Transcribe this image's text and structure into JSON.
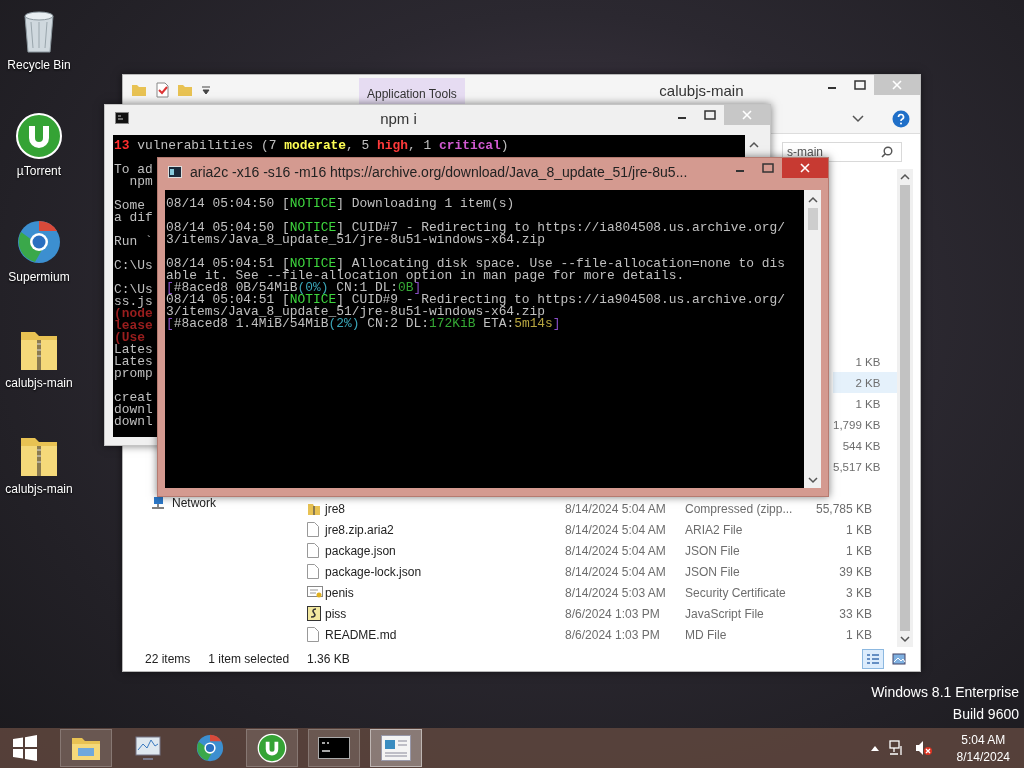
{
  "desktop_icons": [
    {
      "label": "Recycle Bin",
      "kind": "recycle"
    },
    {
      "label": "µTorrent",
      "kind": "utorrent"
    },
    {
      "label": "Supermium",
      "kind": "browser"
    },
    {
      "label": "calubjs-main",
      "kind": "zip"
    },
    {
      "label": "calubjs-main",
      "kind": "zip"
    }
  ],
  "explorer": {
    "title": "calubjs-main",
    "context_tab": "Application Tools",
    "search": {
      "value": "s-main"
    },
    "nav_items": [
      {
        "label": "Network"
      }
    ],
    "rows_behind_windows": [
      {
        "size": "1 KB",
        "selected": false
      },
      {
        "size": "2 KB",
        "selected": true
      },
      {
        "size": "1 KB",
        "selected": false
      },
      {
        "size": "1,799 KB",
        "selected": false
      },
      {
        "size": "544 KB",
        "selected": false
      },
      {
        "size": "5,517 KB",
        "selected": false
      }
    ],
    "rows": [
      {
        "kind": "zip",
        "name": "jre8",
        "date": "8/14/2024 5:04 AM",
        "type": "Compressed (zipp...",
        "size": "55,785 KB",
        "selected": false
      },
      {
        "kind": "file",
        "name": "jre8.zip.aria2",
        "date": "8/14/2024 5:04 AM",
        "type": "ARIA2 File",
        "size": "1 KB",
        "selected": false
      },
      {
        "kind": "file",
        "name": "package.json",
        "date": "8/14/2024 5:04 AM",
        "type": "JSON File",
        "size": "1 KB",
        "selected": false
      },
      {
        "kind": "file",
        "name": "package-lock.json",
        "date": "8/14/2024 5:04 AM",
        "type": "JSON File",
        "size": "39 KB",
        "selected": false
      },
      {
        "kind": "certificate",
        "name": "penis",
        "date": "8/14/2024 5:03 AM",
        "type": "Security Certificate",
        "size": "3 KB",
        "selected": false
      },
      {
        "kind": "script",
        "name": "piss",
        "date": "8/6/2024 1:03 PM",
        "type": "JavaScript File",
        "size": "33 KB",
        "selected": false
      },
      {
        "kind": "file",
        "name": "README.md",
        "date": "8/6/2024 1:03 PM",
        "type": "MD File",
        "size": "1 KB",
        "selected": false
      }
    ],
    "status": {
      "count": "22 items",
      "selection": "1 item selected",
      "selection_size": "1.36 KB"
    },
    "views": [
      {
        "kind": "details",
        "selected": true
      },
      {
        "kind": "tiles",
        "selected": false
      }
    ]
  },
  "npm_window": {
    "title": "npm i",
    "lines": [
      {
        "kind": "text",
        "segments": [
          {
            "text": "13",
            "color": "#ff2d2d"
          },
          {
            "text": " vulnerabilities (7 "
          },
          {
            "text": "moderate",
            "color": "#ffff55"
          },
          {
            "text": ", 5 "
          },
          {
            "text": "high",
            "color": "#ff3b3b"
          },
          {
            "text": ", 1 "
          },
          {
            "text": "critical",
            "color": "#d25ad2"
          },
          {
            "text": ")"
          }
        ]
      },
      {
        "kind": "blank"
      },
      {
        "kind": "text",
        "segments": [
          {
            "text": "To ad"
          }
        ]
      },
      {
        "kind": "text",
        "segments": [
          {
            "text": "  npm"
          }
        ]
      },
      {
        "kind": "blank"
      },
      {
        "kind": "text",
        "segments": [
          {
            "text": "Some"
          }
        ]
      },
      {
        "kind": "text",
        "segments": [
          {
            "text": "a dif"
          }
        ]
      },
      {
        "kind": "blank"
      },
      {
        "kind": "text",
        "segments": [
          {
            "text": "Run `"
          }
        ]
      },
      {
        "kind": "blank"
      },
      {
        "kind": "text",
        "segments": [
          {
            "text": "C:\\Us"
          }
        ]
      },
      {
        "kind": "blank"
      },
      {
        "kind": "text",
        "segments": [
          {
            "text": "C:\\Us"
          }
        ]
      },
      {
        "kind": "text",
        "segments": [
          {
            "text": "ss.js"
          }
        ]
      },
      {
        "kind": "text",
        "segments": [
          {
            "text": "(node",
            "color": "#9a1e1e"
          }
        ]
      },
      {
        "kind": "text",
        "segments": [
          {
            "text": "lease",
            "color": "#9a1e1e"
          }
        ]
      },
      {
        "kind": "text",
        "segments": [
          {
            "text": "(Use",
            "color": "#9a1e1e"
          }
        ]
      },
      {
        "kind": "text",
        "segments": [
          {
            "text": "Lates"
          }
        ]
      },
      {
        "kind": "text",
        "segments": [
          {
            "text": "Lates"
          }
        ]
      },
      {
        "kind": "text",
        "segments": [
          {
            "text": "promp"
          }
        ]
      },
      {
        "kind": "blank"
      },
      {
        "kind": "text",
        "segments": [
          {
            "text": "creat"
          }
        ]
      },
      {
        "kind": "text",
        "segments": [
          {
            "text": "downl"
          }
        ]
      },
      {
        "kind": "text",
        "segments": [
          {
            "text": "downl"
          }
        ]
      }
    ]
  },
  "aria_window": {
    "title": "aria2c  -x16 -s16 -m16 https://archive.org/download/Java_8_update_51/jre-8u5...",
    "lines": [
      {
        "kind": "text",
        "segments": [
          {
            "text": "08/14 05:04:50 ["
          },
          {
            "text": "NOTICE",
            "color": "#3fd83f"
          },
          {
            "text": "] Downloading 1 item(s)"
          }
        ]
      },
      {
        "kind": "blank"
      },
      {
        "kind": "text",
        "segments": [
          {
            "text": "08/14 05:04:50 ["
          },
          {
            "text": "NOTICE",
            "color": "#3fd83f"
          },
          {
            "text": "] CUID#7 - Redirecting to https://ia804508.us.archive.org/"
          }
        ]
      },
      {
        "kind": "text",
        "segments": [
          {
            "text": "3/items/Java_8_update_51/jre-8u51-windows-x64.zip"
          }
        ]
      },
      {
        "kind": "blank"
      },
      {
        "kind": "text",
        "segments": [
          {
            "text": "08/14 05:04:51 ["
          },
          {
            "text": "NOTICE",
            "color": "#3fd83f"
          },
          {
            "text": "] Allocating disk space. Use --file-allocation=none to dis"
          }
        ]
      },
      {
        "kind": "text",
        "segments": [
          {
            "text": "able it. See --file-allocation option in man page for more details."
          }
        ]
      },
      {
        "kind": "text",
        "segments": [
          {
            "text": "[",
            "color": "#8a4fc8"
          },
          {
            "text": "#8aced8 0B/54MiB"
          },
          {
            "text": "(0%)",
            "color": "#3aa6b8"
          },
          {
            "text": " CN:1 DL:"
          },
          {
            "text": "0B",
            "color": "#35a835"
          },
          {
            "text": "]",
            "color": "#8a4fc8"
          }
        ]
      },
      {
        "kind": "text",
        "segments": [
          {
            "text": "08/14 05:04:51 ["
          },
          {
            "text": "NOTICE",
            "color": "#3fd83f"
          },
          {
            "text": "] CUID#9 - Redirecting to https://ia904508.us.archive.org/"
          }
        ]
      },
      {
        "kind": "text",
        "segments": [
          {
            "text": "3/items/Java_8_update_51/jre-8u51-windows-x64.zip"
          }
        ]
      },
      {
        "kind": "text",
        "segments": [
          {
            "text": "[",
            "color": "#8a4fc8"
          },
          {
            "text": "#8aced8 1.4MiB/54MiB"
          },
          {
            "text": "(2%)",
            "color": "#3aa6b8"
          },
          {
            "text": " CN:2 DL:"
          },
          {
            "text": "172KiB",
            "color": "#35a835"
          },
          {
            "text": " ETA:"
          },
          {
            "text": "5m14s",
            "color": "#b8a640"
          },
          {
            "text": "]",
            "color": "#8a4fc8"
          }
        ]
      }
    ]
  },
  "os_edition": "Windows 8.1 Enterprise",
  "os_build": "Build 9600",
  "taskbar": {
    "buttons": [
      {
        "kind": "folder",
        "running": true,
        "selected": false
      },
      {
        "kind": "monitor",
        "running": false,
        "selected": false
      },
      {
        "kind": "browser",
        "running": false,
        "selected": false
      },
      {
        "kind": "utorrent",
        "running": true,
        "selected": false
      },
      {
        "kind": "console",
        "running": true,
        "selected": false
      },
      {
        "kind": "window",
        "running": true,
        "selected": true
      }
    ],
    "clock_time": "5:04 AM",
    "clock_date": "8/14/2024"
  }
}
